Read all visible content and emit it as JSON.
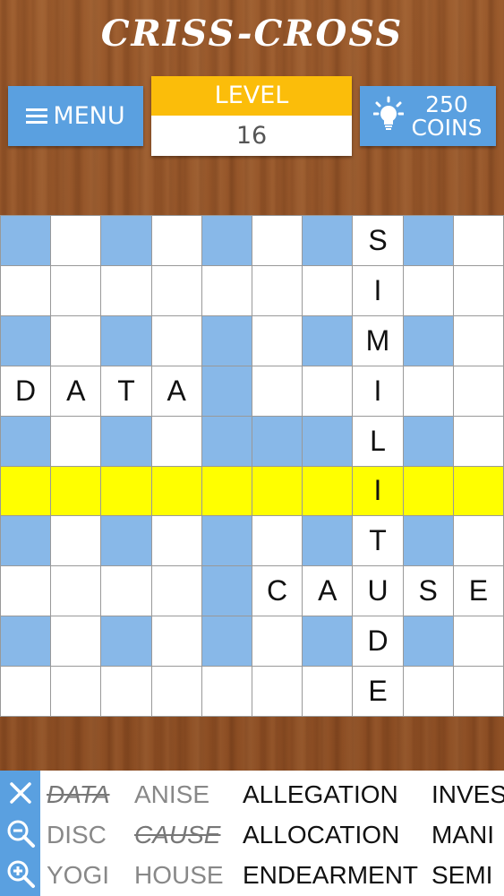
{
  "title": "CRISS-CROSS",
  "menu_label": "MENU",
  "level": {
    "label": "LEVEL",
    "value": "16"
  },
  "coins": {
    "count": "250",
    "label": "COINS"
  },
  "grid": {
    "rows": [
      [
        "",
        "",
        "",
        "",
        "",
        "",
        "",
        "S",
        "",
        ""
      ],
      [
        "",
        "",
        "",
        "",
        "",
        "",
        "",
        "I",
        "",
        ""
      ],
      [
        "",
        "",
        "",
        "",
        "",
        "",
        "",
        "M",
        "",
        ""
      ],
      [
        "D",
        "A",
        "T",
        "A",
        "",
        "",
        "",
        "I",
        "",
        ""
      ],
      [
        "",
        "",
        "",
        "",
        "",
        "",
        "",
        "L",
        "",
        ""
      ],
      [
        "",
        "",
        "",
        "",
        "",
        "",
        "",
        "I",
        "",
        ""
      ],
      [
        "",
        "",
        "",
        "",
        "",
        "",
        "",
        "T",
        "",
        ""
      ],
      [
        "",
        "",
        "",
        "",
        "",
        "C",
        "A",
        "U",
        "S",
        "E"
      ],
      [
        "",
        "",
        "",
        "",
        "",
        "",
        "",
        "D",
        "",
        ""
      ],
      [
        "",
        "",
        "",
        "",
        "",
        "",
        "",
        "E",
        "",
        ""
      ]
    ],
    "shading": [
      [
        "b",
        "w",
        "b",
        "w",
        "b",
        "w",
        "b",
        "w",
        "b",
        "w"
      ],
      [
        "w",
        "w",
        "w",
        "w",
        "w",
        "w",
        "w",
        "w",
        "w",
        "w"
      ],
      [
        "b",
        "w",
        "b",
        "w",
        "b",
        "w",
        "b",
        "w",
        "b",
        "w"
      ],
      [
        "w",
        "w",
        "w",
        "w",
        "b",
        "w",
        "w",
        "w",
        "w",
        "w"
      ],
      [
        "b",
        "w",
        "b",
        "w",
        "b",
        "b",
        "b",
        "w",
        "b",
        "w"
      ],
      [
        "y",
        "y",
        "y",
        "y",
        "y",
        "y",
        "y",
        "y",
        "y",
        "y"
      ],
      [
        "b",
        "w",
        "b",
        "w",
        "b",
        "w",
        "b",
        "w",
        "b",
        "w"
      ],
      [
        "w",
        "w",
        "w",
        "w",
        "b",
        "w",
        "w",
        "w",
        "w",
        "w"
      ],
      [
        "b",
        "w",
        "b",
        "w",
        "b",
        "w",
        "b",
        "w",
        "b",
        "w"
      ],
      [
        "w",
        "w",
        "w",
        "w",
        "w",
        "w",
        "w",
        "w",
        "w",
        "w"
      ]
    ]
  },
  "tools": [
    {
      "icon": "close-icon"
    },
    {
      "icon": "zoom-out-icon"
    },
    {
      "icon": "zoom-in-icon"
    }
  ],
  "word_list": {
    "columns": [
      [
        {
          "text": "DATA",
          "status": "found"
        },
        {
          "text": "DISC",
          "status": "gray"
        },
        {
          "text": "YOGI",
          "status": "gray"
        }
      ],
      [
        {
          "text": "ANISE",
          "status": "gray"
        },
        {
          "text": "CAUSE",
          "status": "found"
        },
        {
          "text": "HOUSE",
          "status": "gray"
        }
      ],
      [
        {
          "text": "ALLEGATION",
          "status": "dark"
        },
        {
          "text": "ALLOCATION",
          "status": "dark"
        },
        {
          "text": "ENDEARMENT",
          "status": "dark"
        }
      ],
      [
        {
          "text": "INVES",
          "status": "dark"
        },
        {
          "text": "MANI",
          "status": "dark"
        },
        {
          "text": "SEMI",
          "status": "dark"
        }
      ]
    ]
  },
  "colors": {
    "button_blue": "#5aa0e0",
    "cell_blue": "#88b8e8",
    "highlight_yellow": "#ffff00",
    "level_orange": "#fbbd0a"
  }
}
